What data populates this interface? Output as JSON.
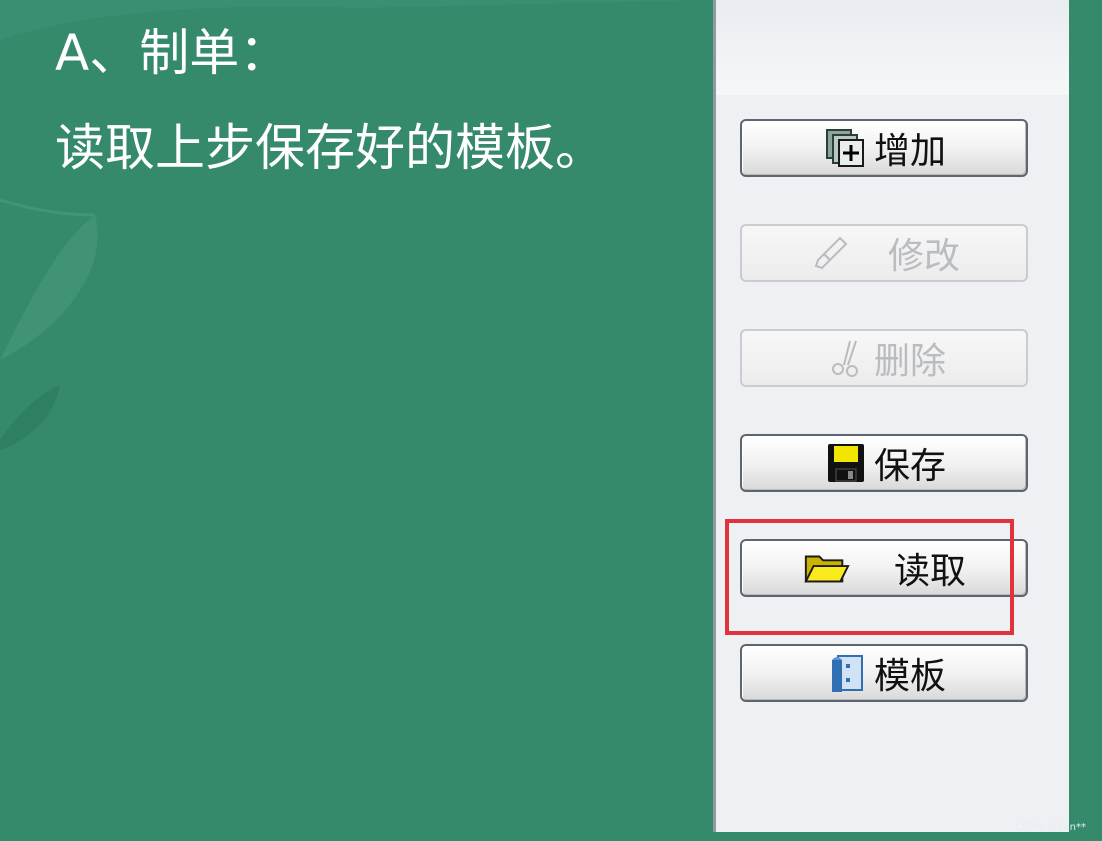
{
  "slide": {
    "heading": "A、制单：",
    "subtitle": "读取上步保存好的模板。"
  },
  "toolbar": {
    "buttons": [
      {
        "label": "增加",
        "icon": "add-document-icon",
        "enabled": true
      },
      {
        "label": "修改",
        "icon": "brush-icon",
        "enabled": false
      },
      {
        "label": "删除",
        "icon": "scissors-icon",
        "enabled": false
      },
      {
        "label": "保存",
        "icon": "floppy-disk-icon",
        "enabled": true
      },
      {
        "label": "读取",
        "icon": "folder-icon",
        "enabled": true
      },
      {
        "label": "模板",
        "icon": "template-icon",
        "enabled": true
      }
    ]
  },
  "watermark": "CSDN @San**",
  "colors": {
    "slide_background": "#358a6c",
    "panel_background": "#eef0f4",
    "highlight_border": "#e0333b"
  }
}
